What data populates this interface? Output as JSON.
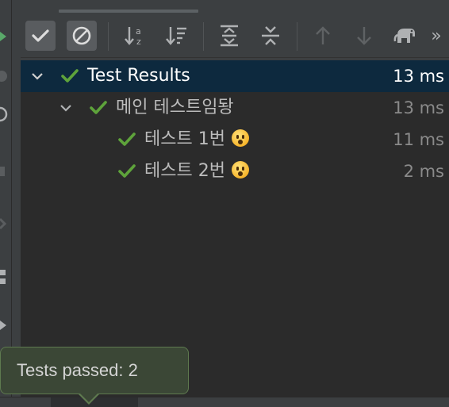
{
  "toolbar": {
    "buttons": [
      {
        "name": "show-passed-toggle",
        "icon": "check-icon"
      },
      {
        "name": "show-ignored-toggle",
        "icon": "ignored-icon"
      },
      {
        "name": "sort-alphabetically-button",
        "icon": "sort-alpha-icon"
      },
      {
        "name": "sort-by-duration-button",
        "icon": "sort-duration-icon"
      },
      {
        "name": "expand-all-button",
        "icon": "expand-all-icon"
      },
      {
        "name": "collapse-all-button",
        "icon": "collapse-all-icon"
      },
      {
        "name": "previous-failed-button",
        "icon": "arrow-up-icon"
      },
      {
        "name": "next-failed-button",
        "icon": "arrow-down-icon"
      },
      {
        "name": "import-tests-button",
        "icon": "elephant-icon"
      },
      {
        "name": "more-actions-button",
        "icon": "double-chevron-right-icon"
      }
    ],
    "more_label": "»"
  },
  "tree": {
    "root": {
      "label": "Test Results",
      "time": "13 ms",
      "status": "passed"
    },
    "suite": {
      "label": "메인 테스트임돵",
      "time": "13 ms",
      "status": "passed"
    },
    "tests": [
      {
        "label": "테스트 1번",
        "time": "11 ms",
        "status": "passed",
        "emoji": "hushed-face"
      },
      {
        "label": "테스트 2번",
        "time": "2 ms",
        "status": "passed",
        "emoji": "hushed-face"
      }
    ]
  },
  "tooltip": {
    "text": "Tests passed: 2"
  },
  "colors": {
    "pass_green": "#5ea33b",
    "selection": "#0d293e",
    "tooltip_bg": "#3b4736",
    "tooltip_border": "#5e7a4f"
  }
}
